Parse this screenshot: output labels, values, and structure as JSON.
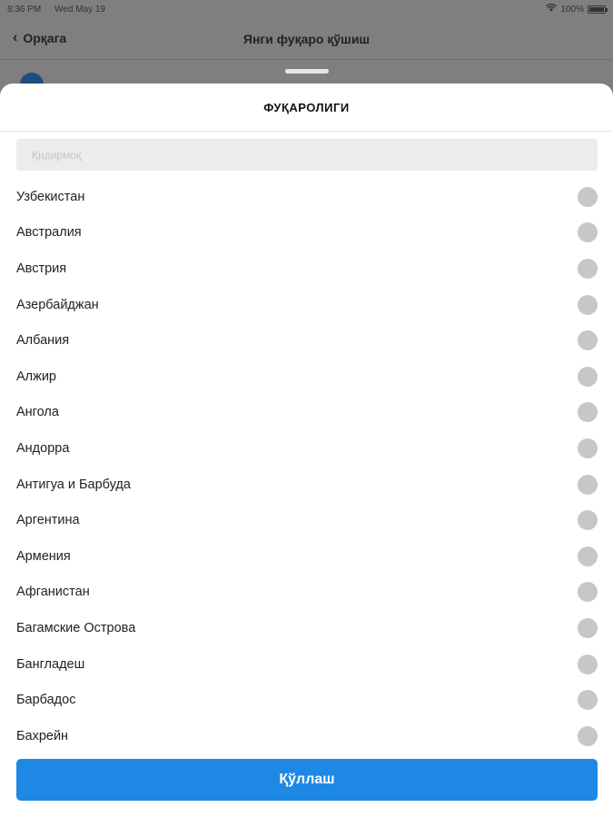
{
  "status_bar": {
    "time": "8:36 PM",
    "date": "Wed May 19",
    "battery": "100%"
  },
  "nav": {
    "back_label": "Орқага",
    "title": "Янги фуқаро қўшиш"
  },
  "sheet": {
    "title": "ФУҚАРОЛИГИ",
    "search": {
      "placeholder": "Қидирмоқ",
      "value": ""
    },
    "countries": [
      "Узбекистан",
      "Австралия",
      "Австрия",
      "Азербайджан",
      "Албания",
      "Алжир",
      "Ангола",
      "Андорра",
      "Антигуа и Барбуда",
      "Аргентина",
      "Армения",
      "Афганистан",
      "Багамские Острова",
      "Бангладеш",
      "Барбадос",
      "Бахрейн"
    ],
    "apply_label": "Қўллаш"
  },
  "colors": {
    "accent": "#1e88e5",
    "radio": "#c7c7c7",
    "overlay": "#7f7f7f"
  }
}
